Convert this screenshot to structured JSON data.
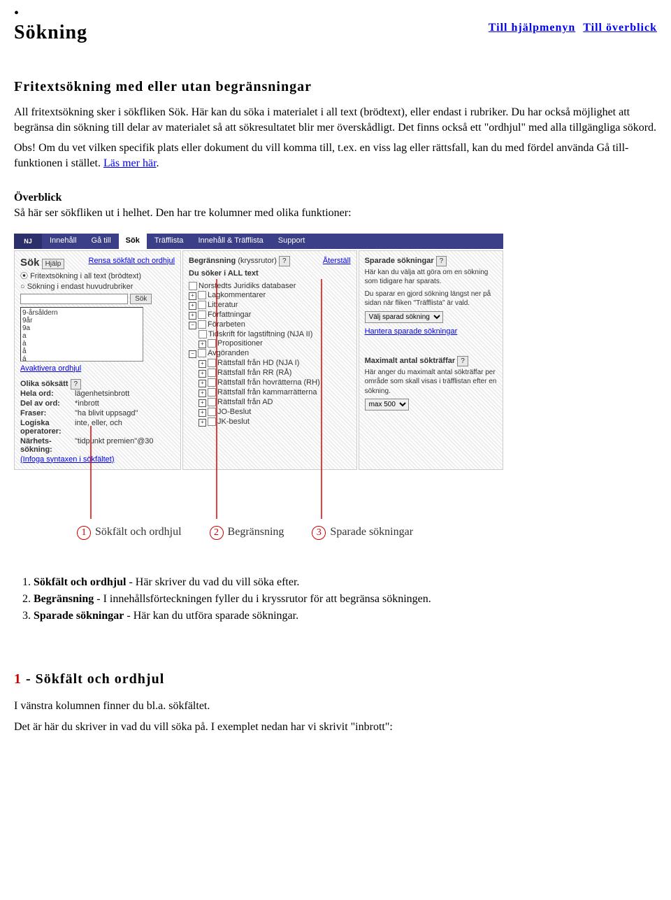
{
  "header": {
    "bullet": "•",
    "title": "Sökning",
    "link_help": "Till hjälpmenyn",
    "link_overview": "Till överblick"
  },
  "subheading": "Fritextsökning med eller utan begränsningar",
  "para1": "All fritextsökning sker i sökfliken Sök.\nHär kan du söka i materialet i all text (brödtext), eller endast i rubriker. Du har också möjlighet att begränsa din sökning till delar av materialet så att sökresultatet blir mer överskådligt. Det finns också ett \"ordhjul\" med alla tillgängliga sökord.",
  "para2a": "Obs! Om du vet vilken specifik plats eller dokument du vill komma till, t.ex. en viss lag eller rättsfall, kan du med fördel använda Gå till-funktionen i stället. ",
  "para2_link": "Läs mer här",
  "para2b": ".",
  "overview_hd": "Överblick",
  "overview_body": "Så här ser sökfliken ut i helhet. Den har tre kolumner med olika funktioner:",
  "shot": {
    "tabs": [
      "Innehåll",
      "Gå till",
      "Sök",
      "Träfflista",
      "Innehåll & Träfflista",
      "Support"
    ],
    "col1": {
      "title": "Sök",
      "help": "Hjälp",
      "clear": "Rensa sökfält och ordhjul",
      "radio1": "Fritextsökning i all text (brödtext)",
      "radio2": "Sökning i endast huvudrubriker",
      "sokbtn": "Sök",
      "wheel": [
        "9-årsåldern",
        "9år",
        "9a",
        "a",
        "à",
        "å",
        "á"
      ],
      "aktivera": "Avaktivera ordhjul",
      "olika_title": "Olika söksätt",
      "olika_q": "?",
      "olika": [
        {
          "lbl": "Hela ord:",
          "val": "lägenhetsinbrott"
        },
        {
          "lbl": "Del av ord:",
          "val": "*inbrott"
        },
        {
          "lbl": "Fraser:",
          "val": "\"ha blivit uppsagd\""
        },
        {
          "lbl": "Logiska operatorer:",
          "val": "inte, eller, och"
        },
        {
          "lbl": "Närhets-sökning:",
          "val": "\"tidpunkt premien\"@30"
        }
      ],
      "infoga": "(Infoga syntaxen i sökfältet)"
    },
    "col2": {
      "title": "Begränsning",
      "kryss": "(kryssrutor)",
      "q": "?",
      "aterstall": "Återställ",
      "soker": "Du söker i ALL text",
      "tree": [
        "Norstedts Juridiks databaser",
        "Lagkommentarer",
        "Litteratur",
        "Författningar",
        "Förarbeten",
        "Tidskrift för lagstiftning (NJA II)",
        "Propositioner",
        "Avgöranden",
        "Rättsfall från HD (NJA I)",
        "Rättsfall från RR (RÅ)",
        "Rättsfall från hovrätterna (RH)",
        "Rättsfall från kammarrätterna",
        "Rättsfall från AD",
        "JO-Beslut",
        "JK-beslut"
      ]
    },
    "col3": {
      "title": "Sparade sökningar",
      "q": "?",
      "p1": "Här kan du välja att göra om en sökning som tidigare har sparats.",
      "p2": "Du sparar en gjord sökning längst ner på sidan när fliken \"Träfflista\" är vald.",
      "select": "Välj sparad sökning",
      "hantera": "Hantera sparade sökningar",
      "max_title": "Maximalt antal sökträffar",
      "max_q": "?",
      "max_p": "Här anger du maximalt antal sökträffar per område som skall visas i träfflistan efter en sökning.",
      "max_sel": "max 500"
    },
    "annot": {
      "a1": "Sökfält och ordhjul",
      "a2": "Begränsning",
      "a3": "Sparade sökningar"
    }
  },
  "list": {
    "i1a": "Sökfält och ordhjul",
    "i1b": " - Här skriver du vad du vill söka efter.",
    "i2a": "Begränsning",
    "i2b": " - I innehållsförteckningen fyller du i kryssrutor för att begränsa sökningen.",
    "i3a": "Sparade sökningar",
    "i3b": " - Här kan du utföra sparade sökningar."
  },
  "section1_num": "1",
  "section1_title": " - Sökfält och ordhjul",
  "footer1": "I vänstra kolumnen finner du bl.a. sökfältet.",
  "footer2": "Det är här du skriver in vad du vill söka på. I exemplet nedan har vi skrivit \"inbrott\":"
}
